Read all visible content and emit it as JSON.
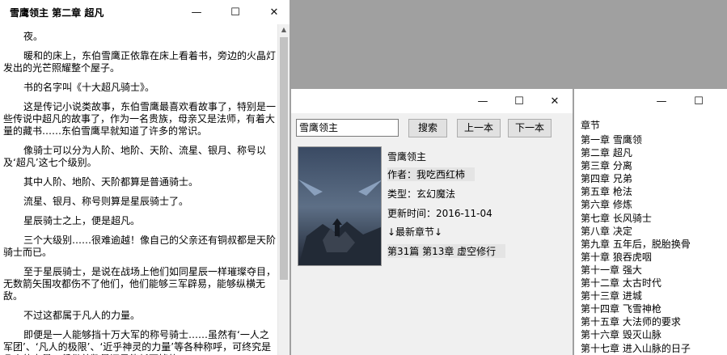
{
  "reader": {
    "title": "雪鹰领主 第二章 超凡",
    "paragraphs": [
      "夜。",
      "暖和的床上，东伯雪鹰正依靠在床上看着书，旁边的火晶灯发出的光芒照耀整个屋子。",
      "书的名字叫《十大超凡骑士》。",
      "这是传记小说类故事，东伯雪鹰最喜欢看故事了，特别是一些传说中超凡的故事了，作为一名贵族，母亲又是法师，有着大量的藏书……东伯雪鹰早就知道了许多的常识。",
      "像骑士可以分为人阶、地阶、天阶、流星、银月、称号以及‘超凡’这七个级别。",
      "其中人阶、地阶、天阶都算是普通骑士。",
      "流星、银月、称号则算是星辰骑士了。",
      "星辰骑士之上，便是超凡。",
      "三个大级别……很难逾越！像自己的父亲还有铜叔都是天阶骑士而已。",
      "至于星辰骑士，是说在战场上他们如同星辰一样璀璨夺目，无数箭矢围攻都伤不了他们，他们能够三军辟易，能够纵横无敌。",
      "不过这都属于凡人的力量。",
      "即便是一人能够挡十万大军的称号骑士……虽然有‘一人之军团’、‘凡人的极限’、‘近乎神灵的力量’等各种称呼，可终究是凡人的力量，凭借着数量还是能耗死掉的。"
    ]
  },
  "search": {
    "input_value": "雪鹰领主",
    "search_label": "搜索",
    "prev_label": "上一本",
    "next_label": "下一本",
    "book_title": "雪鹰领主",
    "author": "作者：我吃西红柿",
    "genre": "类型：玄幻魔法",
    "updated": "更新时间：2016-11-04",
    "latest_label": "↓最新章节↓",
    "latest_chapter": "第31篇 第13章 虚空修行",
    "cover_text": "雪鹰领主"
  },
  "chapters": {
    "header": "章节",
    "items": [
      "第一章 雪鹰领",
      "第二章 超凡",
      "第三章 分离",
      "第四章 兄弟",
      "第五章 枪法",
      "第六章 修炼",
      "第七章 长风骑士",
      "第八章 决定",
      "第九章 五年后，脱胎换骨",
      "第十章 狼吞虎咽",
      "第十一章 强大",
      "第十二章 太古时代",
      "第十三章 进城",
      "第十四章 飞雪神枪",
      "第十五章 大法师的要求",
      "第十六章 毁灭山脉",
      "第十七章 进入山脉的日子"
    ]
  },
  "controls": {
    "minimize": "—",
    "maximize": "☐",
    "close": "✕"
  }
}
